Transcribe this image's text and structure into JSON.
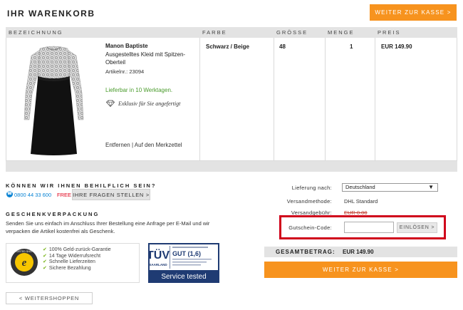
{
  "header": {
    "title": "IHR WARENKORB",
    "checkout_label": "WEITER ZUR KASSE >"
  },
  "table": {
    "columns": [
      "BEZEICHNUNG",
      "FARBE",
      "GRÖSSE",
      "MENGE",
      "PREIS"
    ]
  },
  "item": {
    "brand": "Manon Baptiste",
    "description": "Ausgestelltes Kleid mit Spitzen-Oberteil",
    "article": "Artikelnr.: 23094",
    "delivery": "Lieferbar in 10 Werktagen.",
    "exclusive": "Exklusiv für Sie angefertigt",
    "remove_label": "Entfernen",
    "separator": "|",
    "wishlist_label": "Auf den Merkzettel",
    "color": "Schwarz / Beige",
    "size": "48",
    "quantity": "1",
    "price": "EUR 149.90",
    "image_icon": "dress-product-image"
  },
  "help": {
    "title": "KÖNNEN WIR IHNEN BEHILFLICH SEIN?",
    "phone": "0800 44 33 600",
    "free": "FREE |",
    "ask_button": "IHRE FRAGEN STELLEN >"
  },
  "gift": {
    "title": "GESCHENKVERPACKUNG",
    "text": "Senden Sie uns einfach im Anschluss Ihrer Bestellung eine Anfrage per E-Mail und wir verpacken die Artikel kostenfrei als Geschenk."
  },
  "trust": {
    "seal_label": "TRUSTED SHOPS",
    "guarantees": [
      "100% Geld-zurück-Garantie",
      "14 Tage Widerrufsrecht",
      "Schnelle Lieferzeiten",
      "Sichere Bezahlung"
    ]
  },
  "tuv": {
    "brand": "TÜV",
    "region": "SAARLAND",
    "grade": "GUT (1,6)",
    "service": "Service tested"
  },
  "summary": {
    "delivery_label": "Lieferung nach:",
    "delivery_value": "Deutschland",
    "shipping_method_label": "Versandmethode:",
    "shipping_method_value": "DHL Standard",
    "shipping_fee_label": "Versandgebühr:",
    "shipping_fee_value": "EUR 0.00",
    "coupon_label": "Gutschein-Code:",
    "coupon_value": "",
    "coupon_placeholder": "",
    "coupon_button": "EINLÖSEN >",
    "total_label": "GESAMTBETRAG:",
    "total_value": "EUR 149.90"
  },
  "footer": {
    "continue_shopping": "< WEITERSHOPPEN"
  },
  "colors": {
    "accent": "#f7931e",
    "highlight": "#d0021b",
    "success": "#4a9b2c",
    "link": "#0a84d4"
  }
}
